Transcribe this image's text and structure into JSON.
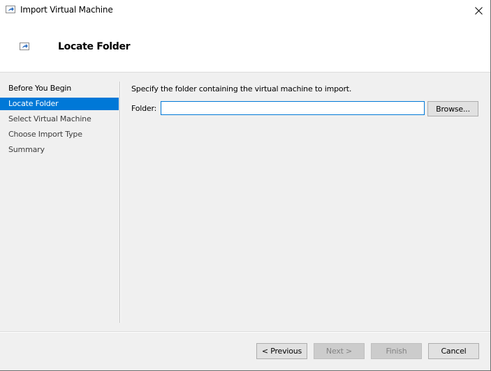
{
  "window": {
    "title": "Import Virtual Machine",
    "app_icon": "import-vm-icon",
    "close_icon": "close-icon"
  },
  "header": {
    "title": "Locate Folder",
    "icon": "import-vm-icon"
  },
  "sidebar": {
    "items": [
      {
        "label": "Before You Begin",
        "state": "done"
      },
      {
        "label": "Locate Folder",
        "state": "active"
      },
      {
        "label": "Select Virtual Machine",
        "state": "pending"
      },
      {
        "label": "Choose Import Type",
        "state": "pending"
      },
      {
        "label": "Summary",
        "state": "pending"
      }
    ]
  },
  "content": {
    "instruction": "Specify the folder containing the virtual machine to import.",
    "folder_label": "Folder:",
    "folder_value": "",
    "browse_label": "Browse..."
  },
  "footer": {
    "previous_label": "< Previous",
    "next_label": "Next >",
    "finish_label": "Finish",
    "cancel_label": "Cancel",
    "next_enabled": false,
    "finish_enabled": false
  },
  "colors": {
    "accent": "#0078d7",
    "background": "#f0f0f0",
    "header_bg": "#ffffff"
  }
}
